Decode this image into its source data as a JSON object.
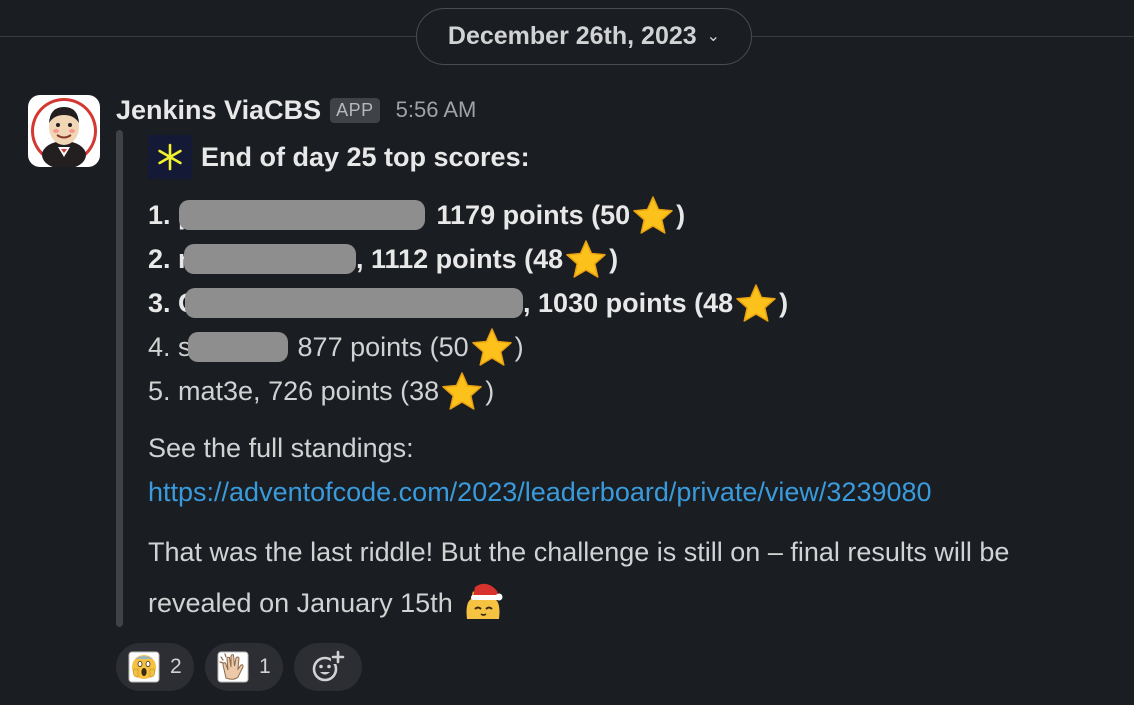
{
  "date_divider": {
    "label": "December 26th, 2023",
    "chevron": "chevron-down-icon"
  },
  "message": {
    "sender": "Jenkins ViaCBS",
    "badge": "APP",
    "time": "5:56 AM",
    "avatar": "jenkins-butler-logo",
    "title": "End of day 25 top scores:",
    "scores": [
      {
        "rank_prefix": "1. p",
        "rest": "1179 points (50",
        "close": ")"
      },
      {
        "rank_prefix": "2. m",
        "rest": ", 1112 points (48",
        "close": ")"
      },
      {
        "rank_prefix": "3. G",
        "rest": ", 1030 points (48",
        "close": ")"
      },
      {
        "rank_prefix": "4. sl",
        "rest": "877 points (50",
        "close": ")"
      },
      {
        "rank_prefix": "5. mat3e, 726 points (38",
        "rest": "",
        "close": ")"
      }
    ],
    "standings_label": "See the full standings:",
    "standings_link": "https://adventofcode.com/2023/leaderboard/private/view/3239080",
    "closing_line1": "That was the last riddle! But the challenge is still on – final results will be",
    "closing_line2": "revealed on January 15th"
  },
  "reactions": [
    {
      "emoji": "scream-face-icon",
      "count": "2"
    },
    {
      "emoji": "clap-icon",
      "count": "1"
    }
  ],
  "colors": {
    "background": "#1a1d21",
    "link": "#3a9bdc",
    "pill": "#2c2e33"
  }
}
